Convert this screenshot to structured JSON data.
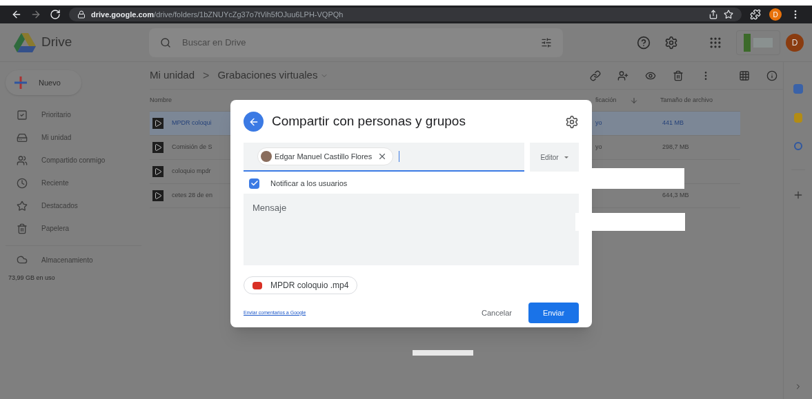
{
  "browser": {
    "url_host": "drive.google.com",
    "url_path": "/drive/folders/1bZNUYcZg37o7tVih5fOJuu6LPH-VQPQh",
    "profile": "D"
  },
  "app": {
    "name": "Drive",
    "search_placeholder": "Buscar en Drive",
    "account": "D"
  },
  "new_button": "Nuevo",
  "breadcrumb": {
    "root": "Mi unidad",
    "separator": ">",
    "current": "Grabaciones virtuales"
  },
  "sidebar": {
    "items": [
      {
        "label": "Prioritario",
        "selected": false
      },
      {
        "label": "Mi unidad",
        "selected": false
      },
      {
        "label": "Compartido conmigo",
        "selected": false
      },
      {
        "label": "Reciente",
        "selected": false
      },
      {
        "label": "Destacados",
        "selected": false
      },
      {
        "label": "Papelera",
        "selected": false
      }
    ],
    "storage": {
      "label": "Almacenamiento",
      "usage": "73,99 GB en uso"
    }
  },
  "table": {
    "columns": [
      "Nombre",
      "ficación",
      "Tamaño de archivo"
    ],
    "rows": [
      {
        "name": "MPDR coloqui",
        "modified": "yo",
        "size": "441 MB",
        "selected": true
      },
      {
        "name": "Comisión de S",
        "modified": "yo",
        "size": "298,7 MB",
        "selected": false
      },
      {
        "name": "coloquio mpdr",
        "selected": false
      },
      {
        "name": "cetes 28 de en",
        "size": "644,3 MB",
        "selected": false
      }
    ]
  },
  "dialog": {
    "title": "Compartir con personas y grupos",
    "recipient": "Edgar Manuel Castillo Flores",
    "role": "Editor",
    "notify": {
      "label": "Notificar a los usuarios",
      "checked": true
    },
    "message_placeholder": "Mensaje",
    "attachment": "MPDR coloquio .mp4",
    "feedback_link": "Enviar comentarios a Google",
    "cancel": "Cancelar",
    "send": "Enviar"
  }
}
